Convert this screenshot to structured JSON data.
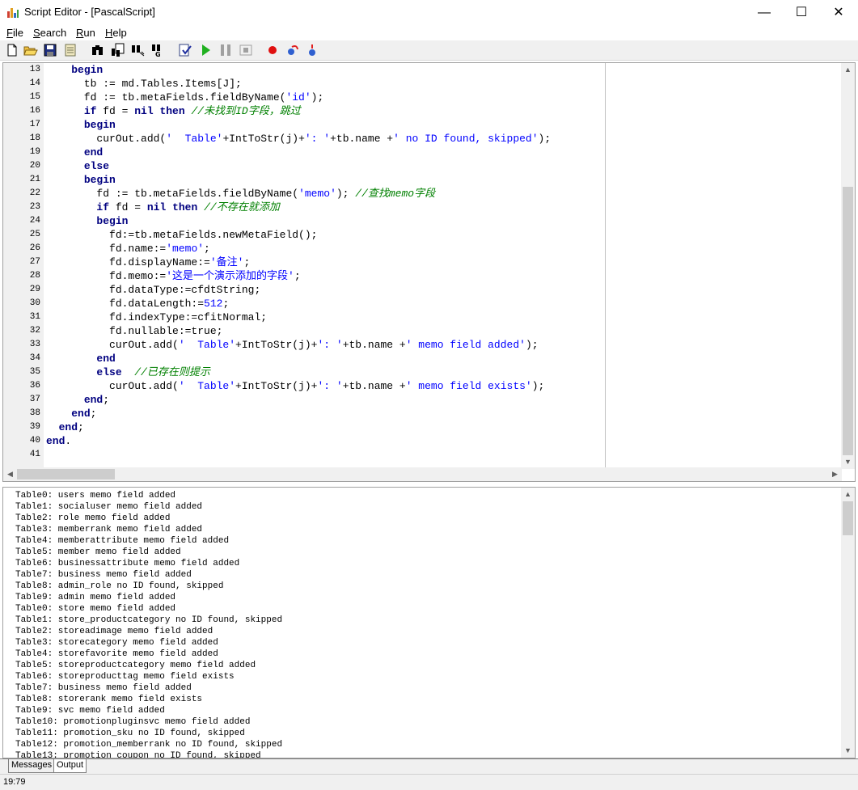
{
  "window": {
    "title": "Script Editor - [PascalScript]",
    "minimize_glyph": "—",
    "maximize_glyph": "☐",
    "close_glyph": "✕"
  },
  "menu": [
    {
      "label": "File",
      "accel": "F",
      "rest": "ile"
    },
    {
      "label": "Search",
      "accel": "S",
      "rest": "earch"
    },
    {
      "label": "Run",
      "accel": "R",
      "rest": "un"
    },
    {
      "label": "Help",
      "accel": "H",
      "rest": "elp"
    }
  ],
  "toolbar": {
    "buttons": [
      "new-file-icon",
      "open-folder-icon",
      "save-icon",
      "print-preview-icon",
      "find-icon",
      "find-in-files-icon",
      "replace-icon",
      "goto-line-icon",
      "syntax-check-icon",
      "run-icon",
      "pause-icon",
      "stop-icon",
      "breakpoint-icon",
      "step-over-icon",
      "step-into-icon"
    ]
  },
  "editor": {
    "line_numbers": [
      "13",
      "14",
      "15",
      "16",
      "17",
      "18",
      "19",
      "20",
      "21",
      "22",
      "23",
      "24",
      "25",
      "26",
      "27",
      "28",
      "29",
      "30",
      "31",
      "32",
      "33",
      "34",
      "35",
      "36",
      "37",
      "38",
      "39",
      "40",
      "41"
    ],
    "lines": [
      [
        {
          "t": "    ",
          "c": ""
        },
        {
          "t": "begin",
          "c": "kw"
        }
      ],
      [
        {
          "t": "      tb := md.Tables.Items[J];",
          "c": ""
        }
      ],
      [
        {
          "t": "      fd := tb.metaFields.fieldByName(",
          "c": ""
        },
        {
          "t": "'id'",
          "c": "str"
        },
        {
          "t": ");",
          "c": ""
        }
      ],
      [
        {
          "t": "      ",
          "c": ""
        },
        {
          "t": "if",
          "c": "kw"
        },
        {
          "t": " fd = ",
          "c": ""
        },
        {
          "t": "nil",
          "c": "kw"
        },
        {
          "t": " ",
          "c": ""
        },
        {
          "t": "then",
          "c": "kw"
        },
        {
          "t": " ",
          "c": ""
        },
        {
          "t": "//未找到ID字段，跳过",
          "c": "cm"
        }
      ],
      [
        {
          "t": "      ",
          "c": ""
        },
        {
          "t": "begin",
          "c": "kw"
        }
      ],
      [
        {
          "t": "        curOut.add(",
          "c": ""
        },
        {
          "t": "'  Table'",
          "c": "str"
        },
        {
          "t": "+IntToStr(j)+",
          "c": ""
        },
        {
          "t": "': '",
          "c": "str"
        },
        {
          "t": "+tb.name +",
          "c": ""
        },
        {
          "t": "' no ID found, skipped'",
          "c": "str"
        },
        {
          "t": ");",
          "c": ""
        }
      ],
      [
        {
          "t": "      ",
          "c": ""
        },
        {
          "t": "end",
          "c": "kw"
        }
      ],
      [
        {
          "t": "      ",
          "c": ""
        },
        {
          "t": "else",
          "c": "kw"
        }
      ],
      [
        {
          "t": "      ",
          "c": ""
        },
        {
          "t": "begin",
          "c": "kw"
        }
      ],
      [
        {
          "t": "        fd := tb.metaFields.fieldByName(",
          "c": ""
        },
        {
          "t": "'memo'",
          "c": "str"
        },
        {
          "t": "); ",
          "c": ""
        },
        {
          "t": "//查找memo字段",
          "c": "cm"
        }
      ],
      [
        {
          "t": "        ",
          "c": ""
        },
        {
          "t": "if",
          "c": "kw"
        },
        {
          "t": " fd = ",
          "c": ""
        },
        {
          "t": "nil",
          "c": "kw"
        },
        {
          "t": " ",
          "c": ""
        },
        {
          "t": "then",
          "c": "kw"
        },
        {
          "t": " ",
          "c": ""
        },
        {
          "t": "//不存在就添加",
          "c": "cm"
        }
      ],
      [
        {
          "t": "        ",
          "c": ""
        },
        {
          "t": "begin",
          "c": "kw"
        }
      ],
      [
        {
          "t": "          fd:=tb.metaFields.newMetaField();",
          "c": ""
        }
      ],
      [
        {
          "t": "          fd.name:=",
          "c": ""
        },
        {
          "t": "'memo'",
          "c": "str"
        },
        {
          "t": ";",
          "c": ""
        }
      ],
      [
        {
          "t": "          fd.displayName:=",
          "c": ""
        },
        {
          "t": "'备注'",
          "c": "str"
        },
        {
          "t": ";",
          "c": ""
        }
      ],
      [
        {
          "t": "          fd.memo:=",
          "c": ""
        },
        {
          "t": "'这是一个演示添加的字段'",
          "c": "str"
        },
        {
          "t": ";",
          "c": ""
        }
      ],
      [
        {
          "t": "          fd.dataType:=cfdtString;",
          "c": ""
        }
      ],
      [
        {
          "t": "          fd.dataLength:=",
          "c": ""
        },
        {
          "t": "512",
          "c": "str"
        },
        {
          "t": ";",
          "c": ""
        }
      ],
      [
        {
          "t": "          fd.indexType:=cfitNormal;",
          "c": ""
        }
      ],
      [
        {
          "t": "          fd.nullable:=true;",
          "c": ""
        }
      ],
      [
        {
          "t": "          curOut.add(",
          "c": ""
        },
        {
          "t": "'  Table'",
          "c": "str"
        },
        {
          "t": "+IntToStr(j)+",
          "c": ""
        },
        {
          "t": "': '",
          "c": "str"
        },
        {
          "t": "+tb.name +",
          "c": ""
        },
        {
          "t": "' memo field added'",
          "c": "str"
        },
        {
          "t": ");",
          "c": ""
        }
      ],
      [
        {
          "t": "        ",
          "c": ""
        },
        {
          "t": "end",
          "c": "kw"
        }
      ],
      [
        {
          "t": "        ",
          "c": ""
        },
        {
          "t": "else",
          "c": "kw"
        },
        {
          "t": "  ",
          "c": ""
        },
        {
          "t": "//已存在则提示",
          "c": "cm"
        }
      ],
      [
        {
          "t": "          curOut.add(",
          "c": ""
        },
        {
          "t": "'  Table'",
          "c": "str"
        },
        {
          "t": "+IntToStr(j)+",
          "c": ""
        },
        {
          "t": "': '",
          "c": "str"
        },
        {
          "t": "+tb.name +",
          "c": ""
        },
        {
          "t": "' memo field exists'",
          "c": "str"
        },
        {
          "t": ");",
          "c": ""
        }
      ],
      [
        {
          "t": "      ",
          "c": ""
        },
        {
          "t": "end",
          "c": "kw"
        },
        {
          "t": ";",
          "c": ""
        }
      ],
      [
        {
          "t": "    ",
          "c": ""
        },
        {
          "t": "end",
          "c": "kw"
        },
        {
          "t": ";",
          "c": ""
        }
      ],
      [
        {
          "t": "  ",
          "c": ""
        },
        {
          "t": "end",
          "c": "kw"
        },
        {
          "t": ";",
          "c": ""
        }
      ],
      [
        {
          "t": "end",
          "c": "kw"
        },
        {
          "t": ".",
          "c": ""
        }
      ],
      [
        {
          "t": "",
          "c": ""
        }
      ]
    ]
  },
  "output": {
    "lines": [
      "Table0: users memo field added",
      "Table1: socialuser memo field added",
      "Table2: role memo field added",
      "Table3: memberrank memo field added",
      "Table4: memberattribute memo field added",
      "Table5: member memo field added",
      "Table6: businessattribute memo field added",
      "Table7: business memo field added",
      "Table8: admin_role no ID found, skipped",
      "Table9: admin memo field added",
      "Table0: store memo field added",
      "Table1: store_productcategory no ID found, skipped",
      "Table2: storeadimage memo field added",
      "Table3: storecategory memo field added",
      "Table4: storefavorite memo field added",
      "Table5: storeproductcategory memo field added",
      "Table6: storeproducttag memo field exists",
      "Table7: business memo field added",
      "Table8: storerank memo field exists",
      "Table9: svc memo field added",
      "Table10: promotionpluginsvc memo field added",
      "Table11: promotion_sku no ID found, skipped",
      "Table12: promotion_memberrank no ID found, skipped",
      "Table13: promotion_coupon no ID found, skipped"
    ]
  },
  "tabs": [
    {
      "label": "Messages",
      "active": false
    },
    {
      "label": "Output",
      "active": true
    }
  ],
  "status": {
    "cursor_position": "19:79"
  },
  "colors": {
    "keyword": "#000080",
    "string": "#0000ff",
    "comment": "#008000"
  }
}
